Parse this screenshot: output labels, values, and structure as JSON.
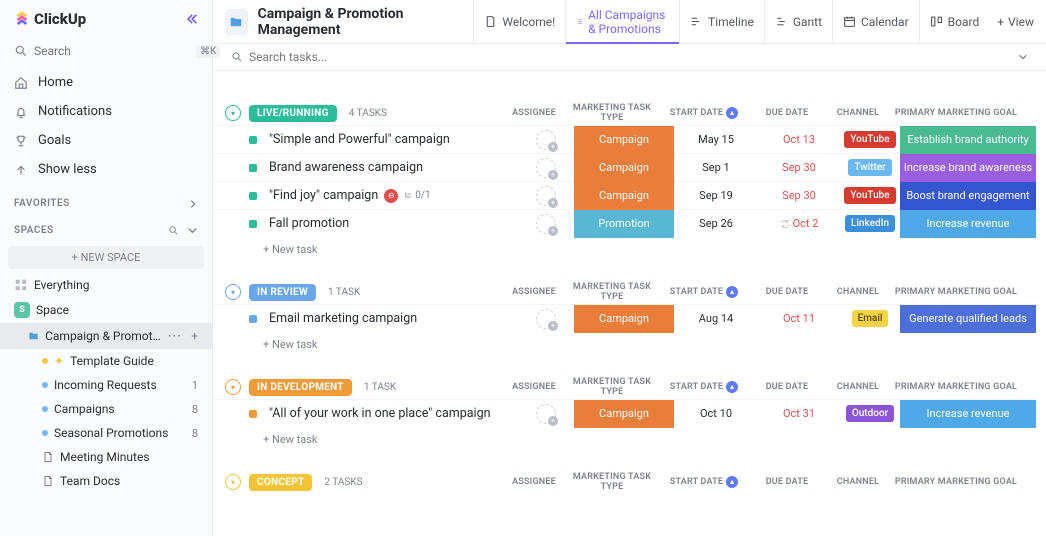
{
  "brand": "ClickUp",
  "sidebar": {
    "search_placeholder": "Search",
    "search_kbd": "⌘K",
    "nav": [
      {
        "label": "Home",
        "icon": "home-icon"
      },
      {
        "label": "Notifications",
        "icon": "bell-icon"
      },
      {
        "label": "Goals",
        "icon": "trophy-icon"
      },
      {
        "label": "Show less",
        "icon": "arrow-up-icon"
      }
    ],
    "favorites_label": "FAVORITES",
    "spaces_label": "SPACES",
    "new_space": "NEW SPACE",
    "everything": "Everything",
    "space_name": "Space",
    "active_folder": "Campaign & Promotion M...",
    "lists": [
      {
        "label": "Template Guide",
        "dot": "#f6c744",
        "wand": true
      },
      {
        "label": "Incoming Requests",
        "dot": "#6fb6ff",
        "count": "1"
      },
      {
        "label": "Campaigns",
        "dot": "#6fb6ff",
        "count": "8"
      },
      {
        "label": "Seasonal Promotions",
        "dot": "#6fb6ff",
        "count": "8"
      }
    ],
    "docs": [
      {
        "label": "Meeting Minutes"
      },
      {
        "label": "Team Docs"
      }
    ]
  },
  "header": {
    "folder_title": "Campaign & Promotion Management",
    "tabs": [
      {
        "label": "Welcome!",
        "icon": "doc-icon"
      },
      {
        "label": "All Campaigns & Promotions",
        "icon": "list-icon",
        "active": true
      },
      {
        "label": "Timeline",
        "icon": "timeline-icon"
      },
      {
        "label": "Gantt",
        "icon": "gantt-icon"
      },
      {
        "label": "Calendar",
        "icon": "calendar-icon"
      },
      {
        "label": "Board",
        "icon": "board-icon"
      }
    ],
    "view_label": "View"
  },
  "searchbar_placeholder": "Search tasks...",
  "columns": [
    "ASSIGNEE",
    "MARKETING TASK TYPE",
    "START DATE",
    "DUE DATE",
    "CHANNEL",
    "PRIMARY MARKETING GOAL"
  ],
  "new_task_label": "+ New task",
  "groups": [
    {
      "name": "LIVE/RUNNING",
      "color": "#2ebd9b",
      "count": "4 TASKS",
      "tasks": [
        {
          "name": "\"Simple and Powerful\" campaign",
          "status": "#2ebd9b",
          "type": "Campaign",
          "type_bg": "#e87e3a",
          "start": "May 15",
          "due": "Oct 13",
          "due_red": true,
          "channel": "YouTube",
          "channel_bg": "#d63b2f",
          "goal": "Establish brand authority",
          "goal_bg": "#4aba91"
        },
        {
          "name": "Brand awareness campaign",
          "status": "#2ebd9b",
          "type": "Campaign",
          "type_bg": "#e87e3a",
          "start": "Sep 1",
          "due": "Sep 30",
          "due_red": true,
          "channel": "Twitter",
          "channel_bg": "#6bb7f0",
          "goal": "Increase brand awareness",
          "goal_bg": "#9a5fe0"
        },
        {
          "name": "\"Find joy\" campaign",
          "status": "#2ebd9b",
          "blocked": true,
          "subtasks": "0/1",
          "type": "Campaign",
          "type_bg": "#e87e3a",
          "start": "Sep 19",
          "due": "Sep 30",
          "due_red": true,
          "channel": "YouTube",
          "channel_bg": "#d63b2f",
          "goal": "Boost brand engagement",
          "goal_bg": "#3457d1"
        },
        {
          "name": "Fall promotion",
          "status": "#2ebd9b",
          "type": "Promotion",
          "type_bg": "#58b8d3",
          "start": "Sep 26",
          "due": "Oct 2",
          "due_red": true,
          "recurring": true,
          "channel": "LinkedIn",
          "channel_bg": "#3c8fd9",
          "goal": "Increase revenue",
          "goal_bg": "#4fa9e8"
        }
      ]
    },
    {
      "name": "IN REVIEW",
      "color": "#6aa7e8",
      "count": "1 TASK",
      "tasks": [
        {
          "name": "Email marketing campaign",
          "status": "#6aa7e8",
          "type": "Campaign",
          "type_bg": "#e87e3a",
          "start": "Aug 14",
          "due": "Oct 11",
          "due_red": true,
          "channel": "Email",
          "channel_bg": "#f4d444",
          "channel_dark": true,
          "goal": "Generate qualified leads",
          "goal_bg": "#4d6fd9"
        }
      ]
    },
    {
      "name": "IN DEVELOPMENT",
      "color": "#f09b3a",
      "count": "1 TASK",
      "tasks": [
        {
          "name": "\"All of your work in one place\" campaign",
          "status": "#f09b3a",
          "type": "Campaign",
          "type_bg": "#e87e3a",
          "start": "Oct 10",
          "due": "Oct 31",
          "due_red": true,
          "channel": "Outdoor",
          "channel_bg": "#8c55d9",
          "goal": "Increase revenue",
          "goal_bg": "#4fa9e8"
        }
      ]
    },
    {
      "name": "CONCEPT",
      "color": "#f4c437",
      "count": "2 TASKS",
      "tasks": []
    }
  ]
}
